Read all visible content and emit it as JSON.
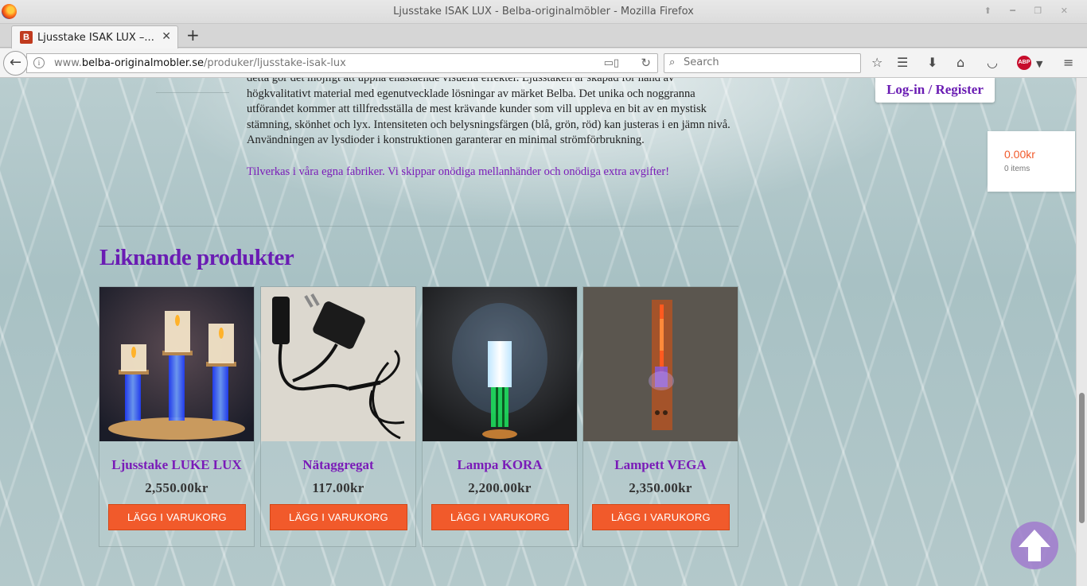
{
  "window": {
    "title": "Ljusstake ISAK LUX - Belba-originalmöbler - Mozilla Firefox"
  },
  "tab": {
    "title": "Ljusstake ISAK LUX –...",
    "favicon_letter": "B",
    "close": "✕",
    "new_tab": "+"
  },
  "navbar": {
    "url_prefix": "www.",
    "url_domain": "belba-originalmobler.se",
    "url_path": "/produker/ljusstake-isak-lux",
    "search_placeholder": "Search",
    "icons": [
      "back-icon",
      "info-icon",
      "reader-view-icon",
      "reload-icon",
      "search-icon",
      "bookmark-star-icon",
      "reading-list-icon",
      "download-icon",
      "home-icon",
      "pocket-icon",
      "adblock-plus-icon",
      "menu-icon"
    ]
  },
  "description": {
    "line_cut": "detta gör det möjligt att uppnå enastående visuella effekter. Ljusstaken är skapad för hand av",
    "lines": "högkvalitativt material med egenutvecklade lösningar av märket Belba. Det unika och noggranna utförandet kommer att tillfredsställa de mest krävande kunder som vill uppleva en bit av en mystisk stämning, skönhet och lyx. Intensiteten och belysningsfärgen (blå, grön, röd) kan justeras i en jämn nivå. Användningen av lysdioder i konstruktionen garanterar en minimal strömförbrukning.",
    "tagline": "Tilverkas i våra egna fabriker. Vi skippar onödiga mellanhänder och onödiga extra avgifter!"
  },
  "header": {
    "login_label": "Log-in / Register"
  },
  "cart": {
    "total": "0.00kr",
    "items": "0 items"
  },
  "related": {
    "title": "Liknande produkter",
    "products": [
      {
        "name": "Ljusstake LUKE LUX",
        "price": "2,550.00kr",
        "button": "LÄGG I VARUKORG"
      },
      {
        "name": "Nätaggregat",
        "price": "117.00kr",
        "button": "LÄGG I VARUKORG"
      },
      {
        "name": "Lampa KORA",
        "price": "2,200.00kr",
        "button": "LÄGG I VARUKORG"
      },
      {
        "name": "Lampett VEGA",
        "price": "2,350.00kr",
        "button": "LÄGG I VARUKORG"
      }
    ]
  },
  "colors": {
    "accent_purple": "#6a1cb3",
    "button_orange": "#f15a2b",
    "scroll_top_button": "#a07dcd"
  }
}
